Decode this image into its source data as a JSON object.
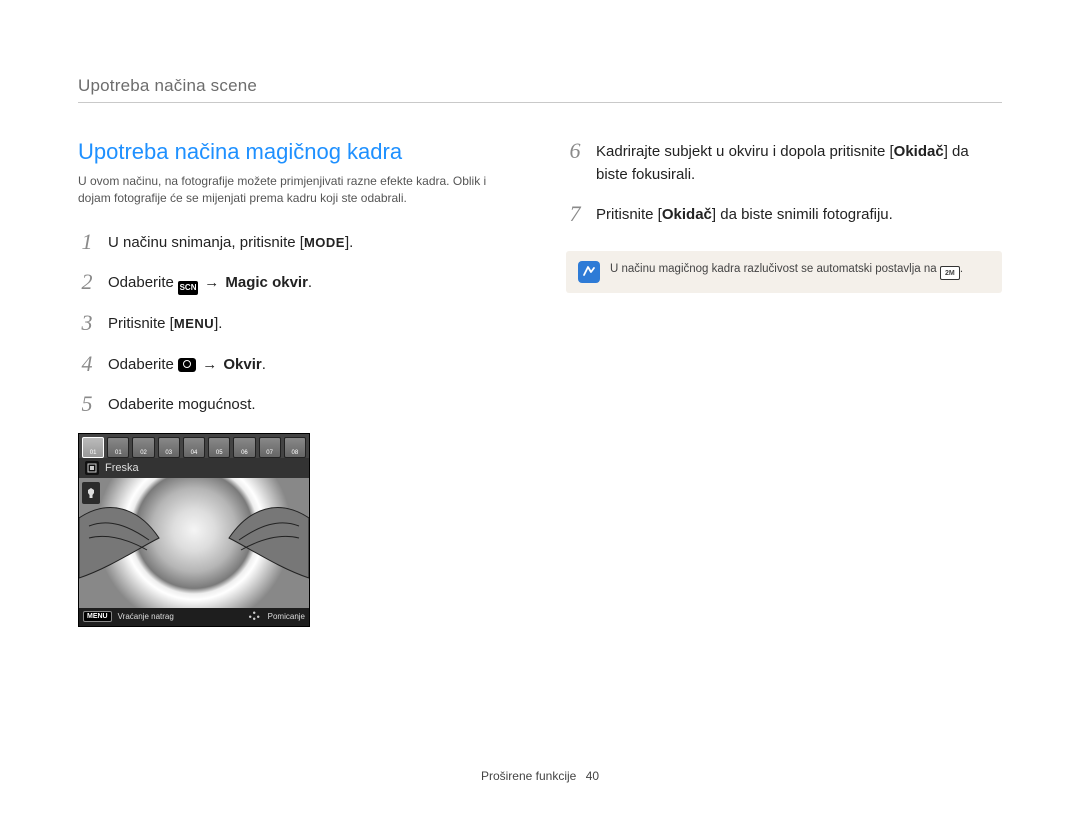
{
  "header": {
    "title": "Upotreba načina scene"
  },
  "section": {
    "title": "Upotreba načina magičnog kadra",
    "intro": "U ovom načinu, na fotografije možete primjenjivati razne efekte kadra. Oblik i dojam fotografije će se mijenjati prema kadru koji ste odabrali."
  },
  "steps": {
    "s1": {
      "num": "1",
      "pre": "U načinu snimanja, pritisnite [",
      "key": "MODE",
      "post": "]."
    },
    "s2": {
      "num": "2",
      "pre": "Odaberite ",
      "icon": "SCN",
      "arrow": "→",
      "bold": "Magic okvir",
      "post": "."
    },
    "s3": {
      "num": "3",
      "pre": "Pritisnite [",
      "key": "MENU",
      "post": "]."
    },
    "s4": {
      "num": "4",
      "pre": "Odaberite ",
      "icon": "camera",
      "arrow": "→",
      "bold": "Okvir",
      "post": "."
    },
    "s5": {
      "num": "5",
      "text": "Odaberite mogućnost."
    },
    "s6": {
      "num": "6",
      "pre": "Kadrirajte subjekt u okviru i dopola pritisnite [",
      "bold": "Okidač",
      "post": "] da biste fokusirali."
    },
    "s7": {
      "num": "7",
      "pre": "Pritisnite [",
      "bold": "Okidač",
      "post": "] da biste snimili fotografiju."
    }
  },
  "camera_ui": {
    "thumbs": [
      "01",
      "01",
      "02",
      "03",
      "04",
      "05",
      "06",
      "07",
      "08"
    ],
    "label": "Freska",
    "status_menu": "MENU",
    "status_back": "Vraćanje natrag",
    "status_move": "Pomicanje"
  },
  "note": {
    "text_pre": "U načinu magičnog kadra razlučivost se automatski postavlja na ",
    "res": "2M",
    "text_post": "."
  },
  "footer": {
    "section": "Proširene funkcije",
    "page": "40"
  }
}
